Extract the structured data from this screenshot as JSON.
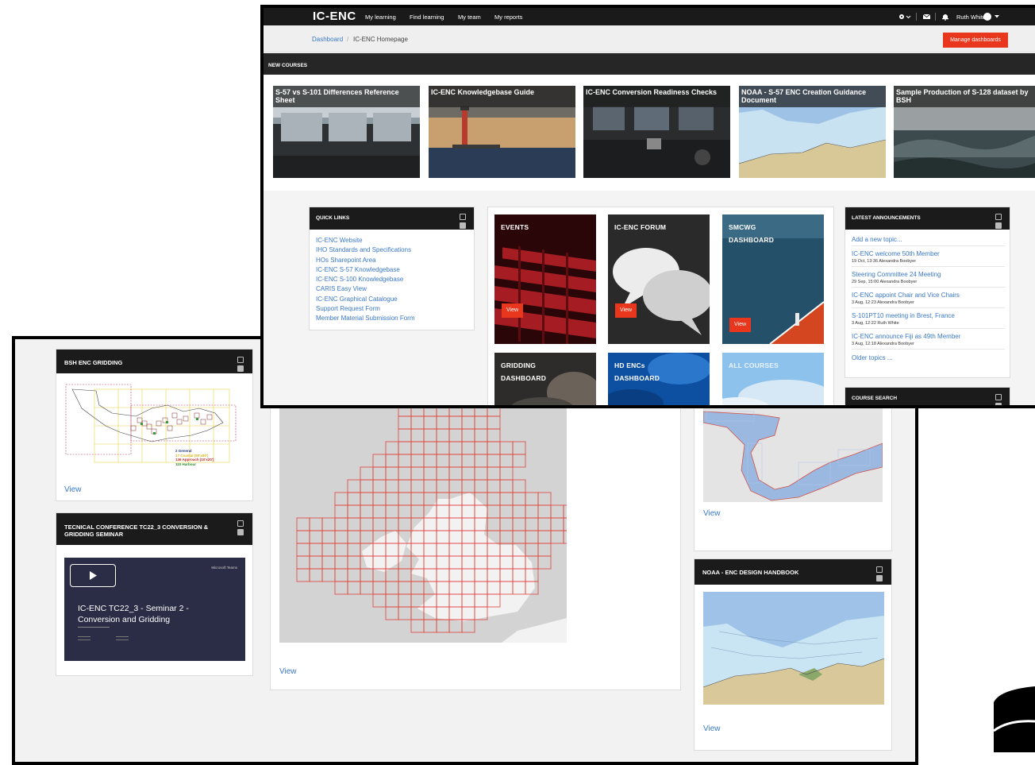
{
  "header": {
    "logo": "IC-ENC",
    "nav": [
      "My learning",
      "Find learning",
      "My team",
      "My reports"
    ],
    "user_name": "Ruth White"
  },
  "breadcrumb": {
    "home": "Dashboard",
    "separator": "/",
    "current": "IC-ENC Homepage"
  },
  "manage_dashboards_label": "Manage dashboards",
  "new_courses": {
    "title": "NEW COURSES",
    "tiles": [
      {
        "title": "S-57 vs S-101 Differences Reference Sheet"
      },
      {
        "title": "IC-ENC Knowledgebase Guide"
      },
      {
        "title": "IC-ENC Conversion Readiness Checks"
      },
      {
        "title": "NOAA - S-57 ENC Creation Guidance Document"
      },
      {
        "title": "Sample Production of S-128 dataset by BSH"
      }
    ]
  },
  "quick_links": {
    "title": "QUICK LINKS",
    "links": [
      "IC-ENC Website",
      "IHO Standards and Specifications",
      "HOs Sharepoint Area",
      "IC-ENC S-57 Knowledgebase",
      "IC-ENC S-100 Knowledgebase",
      "CARIS Easy View",
      "IC-ENC Graphical Catalogue",
      "Support Request Form",
      "Member Material Submission Form"
    ]
  },
  "dashboard_tiles": {
    "events": "EVENTS",
    "forum": "IC-ENC FORUM",
    "smcwg_1": "SMCWG",
    "smcwg_2": "DASHBOARD",
    "gridding_1": "GRIDDING",
    "gridding_2": "DASHBOARD",
    "hd_1": "HD ENCs",
    "hd_2": "DASHBOARD",
    "all_courses": "ALL COURSES",
    "view_label": "View"
  },
  "announcements": {
    "title": "LATEST ANNOUNCEMENTS",
    "add_topic": "Add a new topic...",
    "items": [
      {
        "title": "IC-ENC welcome 50th Member",
        "meta": "19 Oct, 13:36 Alexandra Boobyer"
      },
      {
        "title": "Steering Committee 24 Meeting",
        "meta": "29 Sep, 15:00 Alexandra Boobyer"
      },
      {
        "title": "IC-ENC appoint Chair and Vice Chairs",
        "meta": "3 Aug, 12:23 Alexandra Boobyer"
      },
      {
        "title": "S-101PT10 meeting in Brest, France",
        "meta": "3 Aug, 12:22 Ruth White"
      },
      {
        "title": "IC-ENC announce Fiji as 49th Member",
        "meta": "3 Aug, 12:18 Alexandra Boobyer"
      }
    ],
    "older": "Older topics ..."
  },
  "course_search": {
    "title": "COURSE SEARCH"
  },
  "back": {
    "bsh_title": "BSH ENC GRIDDING",
    "legend": [
      "2 General",
      "17 Coastal (90'x60')",
      "136 Approach (10'x20')",
      "110 Harbour"
    ],
    "tc_title": "TECNICAL CONFERENCE TC22_3 CONVERSION & GRIDDING SEMINAR",
    "video_brand": "Microsoft Teams",
    "video_title_1": "IC-ENC TC22_3 - Seminar 2 -",
    "video_title_2": "Conversion and Gridding",
    "noaa_title": "NOAA - ENC DESIGN HANDBOOK",
    "view_label": "View"
  },
  "colors": {
    "accent": "#e8371c",
    "link": "#3a78c8",
    "header_bg": "#1a1a1a"
  }
}
